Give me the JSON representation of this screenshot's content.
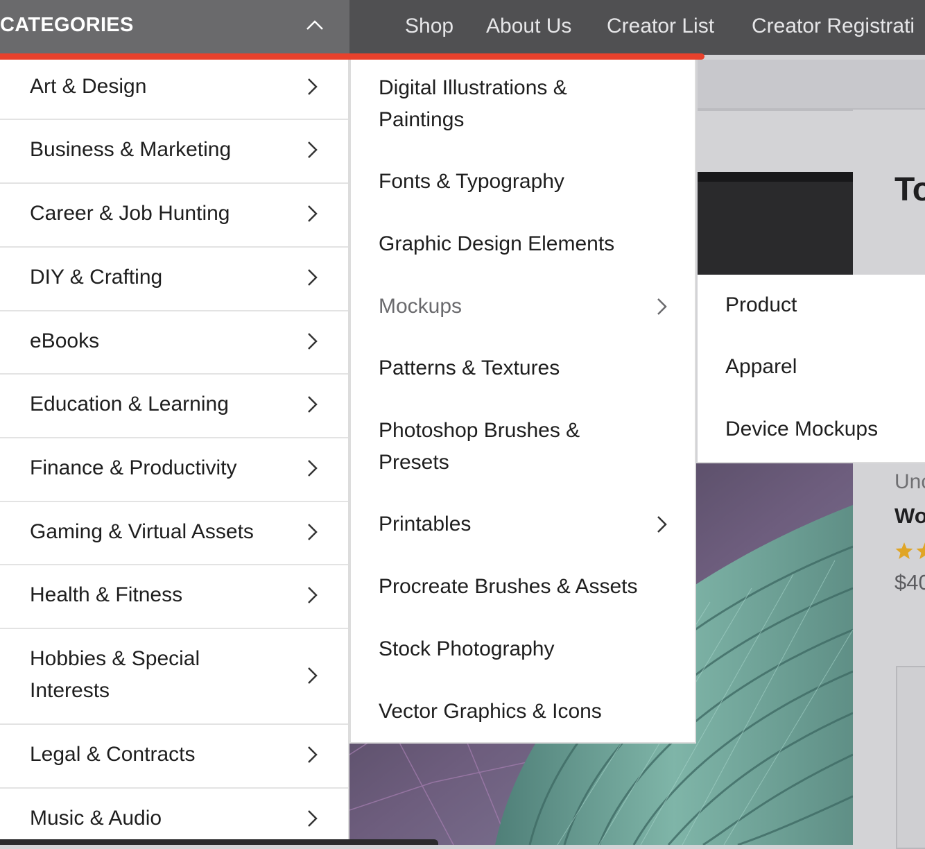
{
  "header": {
    "categories_title": "CATEGORIES",
    "nav": [
      {
        "label": "Shop"
      },
      {
        "label": "About Us"
      },
      {
        "label": "Creator List"
      },
      {
        "label": "Creator Registrati"
      }
    ],
    "accent_color": "#e8412c"
  },
  "categories": [
    {
      "label": "Art & Design"
    },
    {
      "label": "Business & Marketing"
    },
    {
      "label": "Career & Job Hunting"
    },
    {
      "label": "DIY & Crafting"
    },
    {
      "label": "eBooks"
    },
    {
      "label": "Education & Learning"
    },
    {
      "label": "Finance & Productivity"
    },
    {
      "label": "Gaming & Virtual Assets"
    },
    {
      "label": "Health & Fitness"
    },
    {
      "label": "Hobbies & Special Interests"
    },
    {
      "label": "Legal & Contracts"
    },
    {
      "label": "Music & Audio"
    }
  ],
  "art_design_submenu": [
    {
      "label": "Digital Illustrations & Paintings"
    },
    {
      "label": "Fonts & Typography"
    },
    {
      "label": "Graphic Design Elements"
    },
    {
      "label": "Mockups"
    },
    {
      "label": "Patterns & Textures"
    },
    {
      "label": "Photoshop Brushes & Presets"
    },
    {
      "label": "Printables"
    },
    {
      "label": "Procreate Brushes & Assets"
    },
    {
      "label": "Stock Photography"
    },
    {
      "label": "Vector Graphics & Icons"
    }
  ],
  "mockups_submenu": [
    {
      "label": "Product"
    },
    {
      "label": "Apparel"
    },
    {
      "label": "Device Mockups"
    }
  ],
  "background": {
    "heading": "To",
    "sub_label": "Unc",
    "title": "Wo",
    "price": "$40"
  }
}
